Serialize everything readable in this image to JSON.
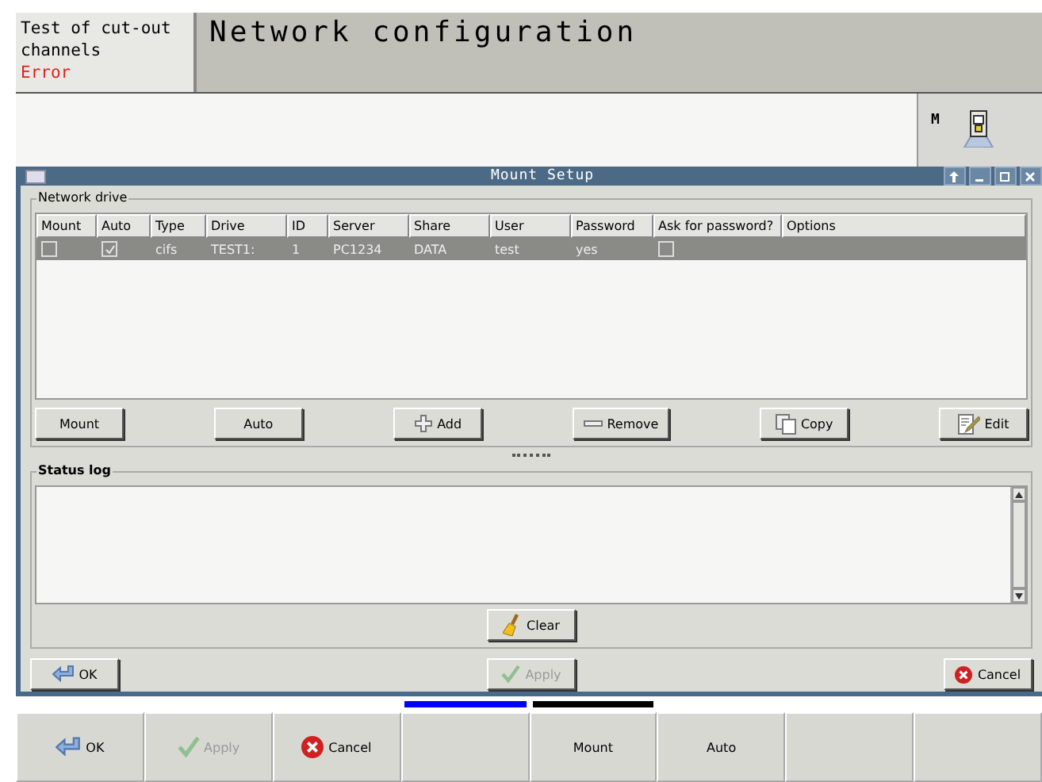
{
  "header": {
    "channel_status": "Test of cut-out channels",
    "error": "Error",
    "title": "Network configuration"
  },
  "side_panel": {
    "label": "M"
  },
  "dialog": {
    "title": "Mount Setup",
    "network_drive": {
      "legend": "Network drive",
      "columns": [
        "Mount",
        "Auto",
        "Type",
        "Drive",
        "ID",
        "Server",
        "Share",
        "User",
        "Password",
        "Ask for password?",
        "Options"
      ],
      "rows": [
        {
          "selected": true,
          "mount": false,
          "auto": true,
          "type": "cifs",
          "drive": "TEST1:",
          "id": "1",
          "server": "PC1234",
          "share": "DATA",
          "user": "test",
          "password": "yes",
          "ask_password": false
        }
      ],
      "buttons": [
        {
          "label": "Mount",
          "kind": "plain"
        },
        {
          "label": "Auto",
          "kind": "plain"
        },
        {
          "label": "Add",
          "kind": "add"
        },
        {
          "label": "Remove",
          "kind": "remove"
        },
        {
          "label": "Copy",
          "kind": "copy"
        },
        {
          "label": "Edit",
          "kind": "edit"
        }
      ]
    },
    "status_log": {
      "legend": "Status log",
      "clear": "Clear"
    },
    "buttons": [
      {
        "label": "OK",
        "kind": "ok",
        "disabled": false
      },
      {
        "label": "Apply",
        "kind": "apply",
        "disabled": true
      },
      {
        "label": "Cancel",
        "kind": "cancel",
        "disabled": false
      }
    ]
  },
  "softkeys": [
    {
      "label": "OK",
      "kind": "ok",
      "disabled": false
    },
    {
      "label": "Apply",
      "kind": "apply",
      "disabled": true
    },
    {
      "label": "Cancel",
      "kind": "cancel",
      "disabled": false
    },
    {
      "kind": "empty",
      "color": "#0000ff"
    },
    {
      "label": "Mount",
      "kind": "plain",
      "disabled": false,
      "color": "#000000"
    },
    {
      "label": "Auto",
      "kind": "plain",
      "disabled": false
    },
    {
      "kind": "empty"
    },
    {
      "kind": "empty"
    }
  ]
}
